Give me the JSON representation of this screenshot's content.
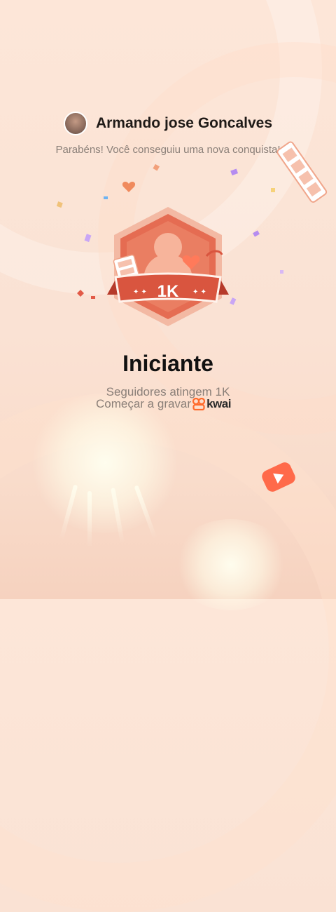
{
  "header": {
    "username": "Armando jose Goncalves"
  },
  "message": {
    "congrats": "Parabéns! Você conseguiu uma nova conquista!"
  },
  "badge": {
    "level": "1K"
  },
  "achievement": {
    "title": "Iniciante",
    "subtitle": "Seguidores atingem 1K",
    "record_label": "Começar a gravar",
    "brand": "kwai"
  },
  "colors": {
    "badge_red": "#d9553f",
    "badge_dark": "#b63a2a",
    "accent_orange": "#ff6a2b"
  }
}
